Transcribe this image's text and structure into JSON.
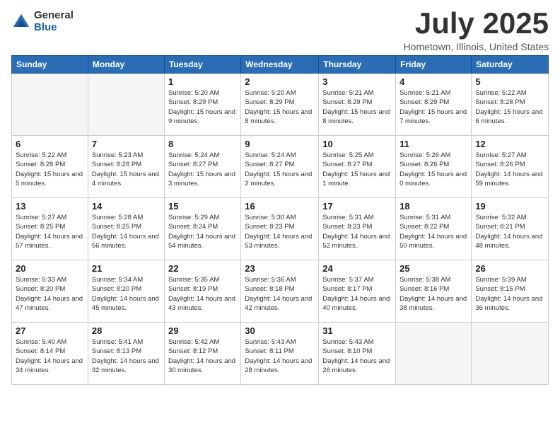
{
  "logo": {
    "general": "General",
    "blue": "Blue"
  },
  "title": {
    "month": "July 2025",
    "location": "Hometown, Illinois, United States"
  },
  "weekdays": [
    "Sunday",
    "Monday",
    "Tuesday",
    "Wednesday",
    "Thursday",
    "Friday",
    "Saturday"
  ],
  "weeks": [
    [
      {
        "day": "",
        "sunrise": "",
        "sunset": "",
        "daylight": "",
        "empty": true
      },
      {
        "day": "",
        "sunrise": "",
        "sunset": "",
        "daylight": "",
        "empty": true
      },
      {
        "day": "1",
        "sunrise": "Sunrise: 5:20 AM",
        "sunset": "Sunset: 8:29 PM",
        "daylight": "Daylight: 15 hours and 9 minutes."
      },
      {
        "day": "2",
        "sunrise": "Sunrise: 5:20 AM",
        "sunset": "Sunset: 8:29 PM",
        "daylight": "Daylight: 15 hours and 8 minutes."
      },
      {
        "day": "3",
        "sunrise": "Sunrise: 5:21 AM",
        "sunset": "Sunset: 8:29 PM",
        "daylight": "Daylight: 15 hours and 8 minutes."
      },
      {
        "day": "4",
        "sunrise": "Sunrise: 5:21 AM",
        "sunset": "Sunset: 8:29 PM",
        "daylight": "Daylight: 15 hours and 7 minutes."
      },
      {
        "day": "5",
        "sunrise": "Sunrise: 5:22 AM",
        "sunset": "Sunset: 8:28 PM",
        "daylight": "Daylight: 15 hours and 6 minutes."
      }
    ],
    [
      {
        "day": "6",
        "sunrise": "Sunrise: 5:22 AM",
        "sunset": "Sunset: 8:28 PM",
        "daylight": "Daylight: 15 hours and 5 minutes."
      },
      {
        "day": "7",
        "sunrise": "Sunrise: 5:23 AM",
        "sunset": "Sunset: 8:28 PM",
        "daylight": "Daylight: 15 hours and 4 minutes."
      },
      {
        "day": "8",
        "sunrise": "Sunrise: 5:24 AM",
        "sunset": "Sunset: 8:27 PM",
        "daylight": "Daylight: 15 hours and 3 minutes."
      },
      {
        "day": "9",
        "sunrise": "Sunrise: 5:24 AM",
        "sunset": "Sunset: 8:27 PM",
        "daylight": "Daylight: 15 hours and 2 minutes."
      },
      {
        "day": "10",
        "sunrise": "Sunrise: 5:25 AM",
        "sunset": "Sunset: 8:27 PM",
        "daylight": "Daylight: 15 hours and 1 minute."
      },
      {
        "day": "11",
        "sunrise": "Sunrise: 5:26 AM",
        "sunset": "Sunset: 8:26 PM",
        "daylight": "Daylight: 15 hours and 0 minutes."
      },
      {
        "day": "12",
        "sunrise": "Sunrise: 5:27 AM",
        "sunset": "Sunset: 8:26 PM",
        "daylight": "Daylight: 14 hours and 59 minutes."
      }
    ],
    [
      {
        "day": "13",
        "sunrise": "Sunrise: 5:27 AM",
        "sunset": "Sunset: 8:25 PM",
        "daylight": "Daylight: 14 hours and 57 minutes."
      },
      {
        "day": "14",
        "sunrise": "Sunrise: 5:28 AM",
        "sunset": "Sunset: 8:25 PM",
        "daylight": "Daylight: 14 hours and 56 minutes."
      },
      {
        "day": "15",
        "sunrise": "Sunrise: 5:29 AM",
        "sunset": "Sunset: 8:24 PM",
        "daylight": "Daylight: 14 hours and 54 minutes."
      },
      {
        "day": "16",
        "sunrise": "Sunrise: 5:30 AM",
        "sunset": "Sunset: 8:23 PM",
        "daylight": "Daylight: 14 hours and 53 minutes."
      },
      {
        "day": "17",
        "sunrise": "Sunrise: 5:31 AM",
        "sunset": "Sunset: 8:23 PM",
        "daylight": "Daylight: 14 hours and 52 minutes."
      },
      {
        "day": "18",
        "sunrise": "Sunrise: 5:31 AM",
        "sunset": "Sunset: 8:22 PM",
        "daylight": "Daylight: 14 hours and 50 minutes."
      },
      {
        "day": "19",
        "sunrise": "Sunrise: 5:32 AM",
        "sunset": "Sunset: 8:21 PM",
        "daylight": "Daylight: 14 hours and 48 minutes."
      }
    ],
    [
      {
        "day": "20",
        "sunrise": "Sunrise: 5:33 AM",
        "sunset": "Sunset: 8:20 PM",
        "daylight": "Daylight: 14 hours and 47 minutes."
      },
      {
        "day": "21",
        "sunrise": "Sunrise: 5:34 AM",
        "sunset": "Sunset: 8:20 PM",
        "daylight": "Daylight: 14 hours and 45 minutes."
      },
      {
        "day": "22",
        "sunrise": "Sunrise: 5:35 AM",
        "sunset": "Sunset: 8:19 PM",
        "daylight": "Daylight: 14 hours and 43 minutes."
      },
      {
        "day": "23",
        "sunrise": "Sunrise: 5:36 AM",
        "sunset": "Sunset: 8:18 PM",
        "daylight": "Daylight: 14 hours and 42 minutes."
      },
      {
        "day": "24",
        "sunrise": "Sunrise: 5:37 AM",
        "sunset": "Sunset: 8:17 PM",
        "daylight": "Daylight: 14 hours and 40 minutes."
      },
      {
        "day": "25",
        "sunrise": "Sunrise: 5:38 AM",
        "sunset": "Sunset: 8:16 PM",
        "daylight": "Daylight: 14 hours and 38 minutes."
      },
      {
        "day": "26",
        "sunrise": "Sunrise: 5:39 AM",
        "sunset": "Sunset: 8:15 PM",
        "daylight": "Daylight: 14 hours and 36 minutes."
      }
    ],
    [
      {
        "day": "27",
        "sunrise": "Sunrise: 5:40 AM",
        "sunset": "Sunset: 8:14 PM",
        "daylight": "Daylight: 14 hours and 34 minutes."
      },
      {
        "day": "28",
        "sunrise": "Sunrise: 5:41 AM",
        "sunset": "Sunset: 8:13 PM",
        "daylight": "Daylight: 14 hours and 32 minutes."
      },
      {
        "day": "29",
        "sunrise": "Sunrise: 5:42 AM",
        "sunset": "Sunset: 8:12 PM",
        "daylight": "Daylight: 14 hours and 30 minutes."
      },
      {
        "day": "30",
        "sunrise": "Sunrise: 5:43 AM",
        "sunset": "Sunset: 8:11 PM",
        "daylight": "Daylight: 14 hours and 28 minutes."
      },
      {
        "day": "31",
        "sunrise": "Sunrise: 5:43 AM",
        "sunset": "Sunset: 8:10 PM",
        "daylight": "Daylight: 14 hours and 26 minutes."
      },
      {
        "day": "",
        "sunrise": "",
        "sunset": "",
        "daylight": "",
        "empty": true
      },
      {
        "day": "",
        "sunrise": "",
        "sunset": "",
        "daylight": "",
        "empty": true
      }
    ]
  ]
}
